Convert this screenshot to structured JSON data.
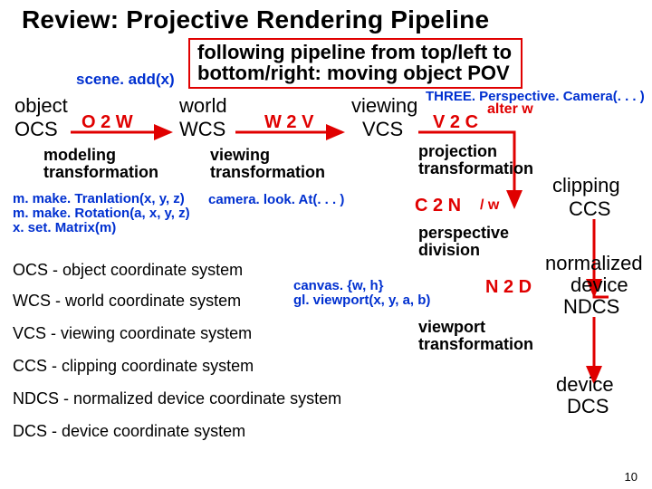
{
  "title": "Review: Projective Rendering Pipeline",
  "subtitle_line1": "following pipeline from top/left to",
  "subtitle_line2": "bottom/right: moving object POV",
  "scene_add": "scene. add(x)",
  "node": {
    "object": "object",
    "ocs": "OCS",
    "world": "world",
    "wcs": "WCS",
    "viewing": "viewing",
    "vcs": "VCS",
    "clipping": "clipping",
    "ccs": "CCS",
    "normalized": "normalized",
    "device_upper": "device",
    "ndcs": "NDCS",
    "device_lower": "device",
    "dcs": "DCS"
  },
  "edge": {
    "o2w": "O 2 W",
    "w2v": "W 2 V",
    "v2c": "V 2 C",
    "c2n": "C 2 N",
    "n2d": "N 2 D",
    "div_w": "/ w",
    "alter_w": "alter w"
  },
  "xform": {
    "modeling_l1": "modeling",
    "modeling_l2": "transformation",
    "viewing_l1": "viewing",
    "viewing_l2": "transformation",
    "projection_l1": "projection",
    "projection_l2": "transformation",
    "perspective_l1": "perspective",
    "perspective_l2": "division",
    "viewport_l1": "viewport",
    "viewport_l2": "transformation"
  },
  "api": {
    "make_translation": "m. make. Tranlation(x, y, z)",
    "make_rotation": "m. make. Rotation(a, x, y, z)",
    "set_matrix": "x. set. Matrix(m)",
    "look_at": "camera. look. At(. . . )",
    "perspective_camera": "THREE. Perspective. Camera(. . . )",
    "canvas_wh": "canvas. {w, h}",
    "gl_viewport": "gl. viewport(x, y, a, b)"
  },
  "legend": {
    "ocs": "OCS - object coordinate system",
    "wcs": "WCS - world coordinate system",
    "vcs": "VCS - viewing coordinate system",
    "ccs": "CCS - clipping coordinate system",
    "ndcs": "NDCS - normalized device coordinate system",
    "dcs": "DCS - device coordinate system"
  },
  "page_number": "10"
}
